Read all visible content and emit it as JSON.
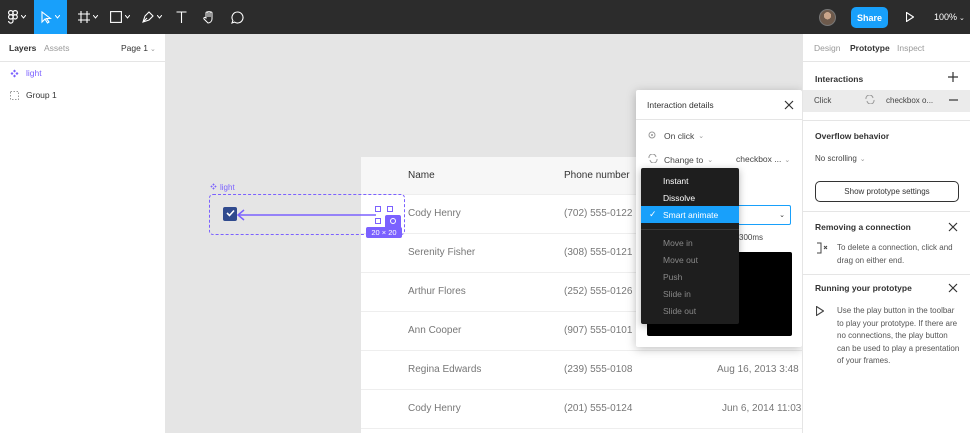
{
  "toolbar": {
    "share_label": "Share",
    "zoom_label": "100%"
  },
  "left_panel": {
    "tabs": [
      "Layers",
      "Assets"
    ],
    "page_label": "Page 1",
    "layers": [
      {
        "label": "light",
        "type": "component"
      },
      {
        "label": "Group 1",
        "type": "group"
      }
    ]
  },
  "canvas": {
    "component_label": "light",
    "size_tag": "20 × 20",
    "table": {
      "columns": [
        "Name",
        "Phone number"
      ],
      "rows": [
        {
          "name": "Cody Henry",
          "phone": "(702) 555-0122",
          "date": ""
        },
        {
          "name": "Serenity Fisher",
          "phone": "(308) 555-0121",
          "date": ""
        },
        {
          "name": "Arthur Flores",
          "phone": "(252) 555-0126",
          "date": ""
        },
        {
          "name": "Ann Cooper",
          "phone": "(907) 555-0101",
          "date": ""
        },
        {
          "name": "Regina Edwards",
          "phone": "(239) 555-0108",
          "date": "Aug 16, 2013 3:48"
        },
        {
          "name": "Cody Henry",
          "phone": "(201) 555-0124",
          "date": "Jun 6, 2014 11:03"
        }
      ]
    }
  },
  "interaction_popup": {
    "title": "Interaction details",
    "trigger": "On click",
    "action": "Change to",
    "destination": "checkbox ...",
    "duration": "300ms"
  },
  "animation_menu": {
    "items": [
      {
        "label": "Instant",
        "state": "normal"
      },
      {
        "label": "Dissolve",
        "state": "normal"
      },
      {
        "label": "Smart animate",
        "state": "selected"
      },
      {
        "label": "Move in",
        "state": "disabled"
      },
      {
        "label": "Move out",
        "state": "disabled"
      },
      {
        "label": "Push",
        "state": "disabled"
      },
      {
        "label": "Slide in",
        "state": "disabled"
      },
      {
        "label": "Slide out",
        "state": "disabled"
      }
    ]
  },
  "right_panel": {
    "tabs": [
      "Design",
      "Prototype",
      "Inspect"
    ],
    "interactions_title": "Interactions",
    "interaction_trigger": "Click",
    "interaction_target": "checkbox o...",
    "overflow_title": "Overflow behavior",
    "overflow_value": "No scrolling",
    "show_settings_label": "Show prototype settings",
    "removing_title": "Removing a connection",
    "removing_text": "To delete a connection, click and drag on either end.",
    "running_title": "Running your prototype",
    "running_text": "Use the play button in the toolbar to play your prototype. If there are no connections, the play button can be used to play a presentation of your frames."
  },
  "colors": {
    "accent": "#18a0fb",
    "component": "#7b61ff",
    "toolbar_bg": "#2c2c2c",
    "checkbox": "#304a8e"
  }
}
